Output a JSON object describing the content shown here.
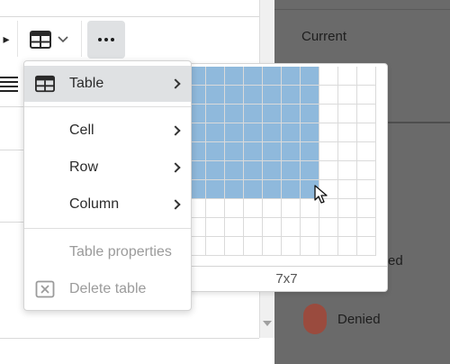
{
  "toolbar": {
    "table_button_icon": "table-icon",
    "more_button_icon": "more-horizontal-icon"
  },
  "menu": {
    "items": [
      {
        "label": "Table",
        "icon": "table-icon",
        "submenu": true,
        "state": "active"
      },
      {
        "label": "Cell",
        "icon": "",
        "submenu": true,
        "state": "enabled"
      },
      {
        "label": "Row",
        "icon": "",
        "submenu": true,
        "state": "enabled"
      },
      {
        "label": "Column",
        "icon": "",
        "submenu": true,
        "state": "enabled"
      },
      {
        "label": "Table properties",
        "icon": "",
        "submenu": false,
        "state": "disabled"
      },
      {
        "label": "Delete table",
        "icon": "delete-table-icon",
        "submenu": false,
        "state": "disabled"
      }
    ]
  },
  "grid_picker": {
    "rows": 10,
    "cols": 10,
    "selected_rows": 7,
    "selected_cols": 7,
    "size_label": "7x7",
    "highlight_color": "#8fb9dc"
  },
  "side_panel": {
    "current_label": "Current",
    "partial_label": "ed",
    "denied_label": "Denied",
    "denied_color": "#9a4b3e"
  }
}
